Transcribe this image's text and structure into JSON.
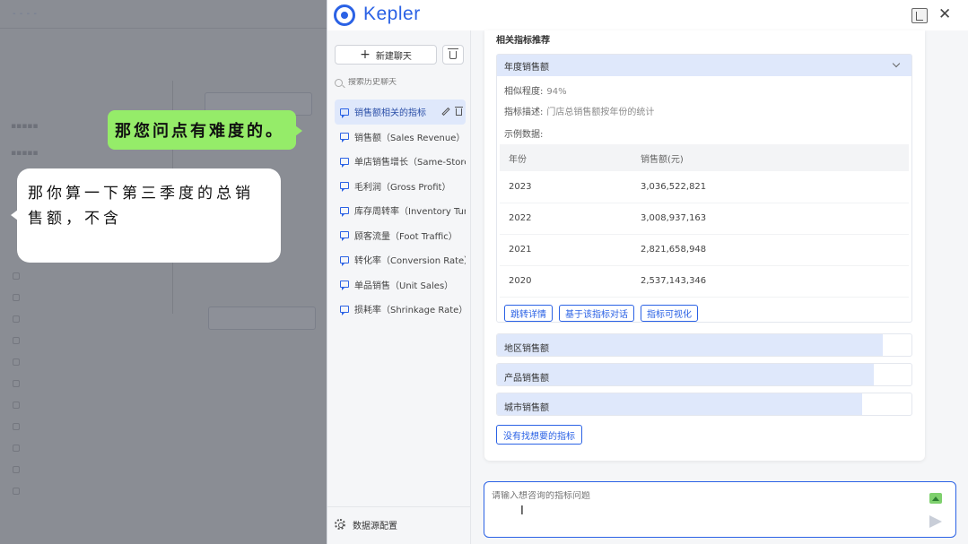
{
  "overlay": {
    "bubble_green": "那您问点有难度的。",
    "bubble_white": "那你算一下第三季度的总销售额，不含"
  },
  "app": {
    "name": "Kepler",
    "accent_color": "#2b62e5"
  },
  "header": {
    "layout_icon": "layout-toggle-icon",
    "close_icon": "close-icon",
    "close_glyph": "✕"
  },
  "sidebar": {
    "new_chat_label": "新建聊天",
    "search_placeholder": "搜索历史聊天",
    "conversations": [
      {
        "label": "销售额相关的指标"
      },
      {
        "label": "销售额（Sales Revenue）"
      },
      {
        "label": "单店销售增长（Same-Store Sales）"
      },
      {
        "label": "毛利润（Gross Profit）"
      },
      {
        "label": "库存周转率（Inventory Turnover）"
      },
      {
        "label": "顾客流量（Foot Traffic）"
      },
      {
        "label": "转化率（Conversion Rate）"
      },
      {
        "label": "单品销售（Unit Sales）"
      },
      {
        "label": "损耗率（Shrinkage Rate）"
      }
    ],
    "footer_label": "数据源配置"
  },
  "card": {
    "title": "相关指标推荐",
    "primary_metric": {
      "name": "年度销售额",
      "similarity_label": "相似程度:",
      "similarity_value": "94%",
      "desc_label": "指标描述:",
      "desc_value": "门店总销售额按年份的统计",
      "example_label": "示例数据:",
      "columns": [
        "年份",
        "销售额(元)"
      ],
      "rows": [
        [
          "2023",
          "3,036,522,821"
        ],
        [
          "2022",
          "3,008,937,163"
        ],
        [
          "2021",
          "2,821,658,948"
        ],
        [
          "2020",
          "2,537,143,346"
        ]
      ],
      "actions": [
        "跳转详情",
        "基于该指标对话",
        "指标可视化"
      ]
    },
    "other_metrics": [
      {
        "name": "地区销售额",
        "similarity": 0.93
      },
      {
        "name": "产品销售额",
        "similarity": 0.91
      },
      {
        "name": "城市销售额",
        "similarity": 0.88
      }
    ],
    "missing_label": "没有找想要的指标"
  },
  "composer": {
    "placeholder": "请输入想咨询的指标问题"
  }
}
